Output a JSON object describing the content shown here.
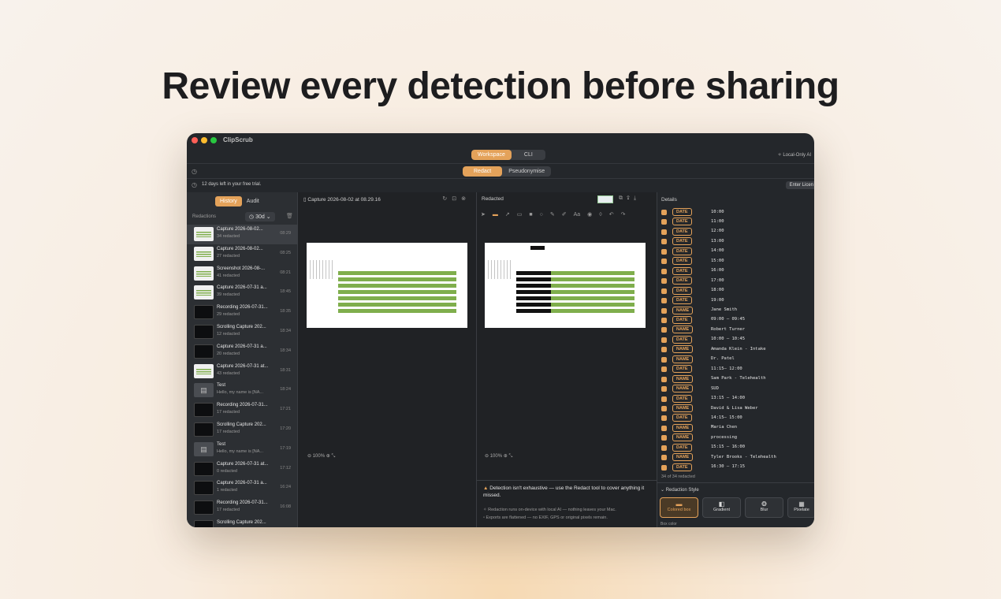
{
  "headline": "Review every detection before sharing",
  "app_title": "ClipScrub",
  "mode_tabs": [
    "Workspace",
    "CLI"
  ],
  "action_tabs": [
    "Redact",
    "Pseudonymise"
  ],
  "local_ai": "Local-Only AI",
  "trial_text": "12 days left in your free trial.",
  "enter_license": "Enter Licen",
  "left_tabs": [
    "History",
    "Audit"
  ],
  "redactions_label": "Redactions",
  "duration": "30d",
  "history": [
    {
      "name": "Capture 2026-08-02...",
      "sub": "34 redacted",
      "time": "08:29",
      "thumb": "light"
    },
    {
      "name": "Capture 2026-08-02...",
      "sub": "27 redacted",
      "time": "08:25",
      "thumb": "light"
    },
    {
      "name": "Screenshot 2026-08-...",
      "sub": "41 redacted",
      "time": "08:21",
      "thumb": "light"
    },
    {
      "name": "Capture 2026-07-31 a...",
      "sub": "39 redacted",
      "time": "18:45",
      "thumb": "light"
    },
    {
      "name": "Recording 2026-07-31...",
      "sub": "29 redacted",
      "time": "18:35",
      "thumb": "dark"
    },
    {
      "name": "Scrolling Capture 202...",
      "sub": "12 redacted",
      "time": "18:34",
      "thumb": "dark"
    },
    {
      "name": "Capture 2026-07-31 a...",
      "sub": "20 redacted",
      "time": "18:34",
      "thumb": "dark"
    },
    {
      "name": "Capture 2026-07-31 at...",
      "sub": "43 redacted",
      "time": "18:31",
      "thumb": "light"
    },
    {
      "name": "Test",
      "sub": "Hello, my name is [NA...",
      "time": "18:24",
      "thumb": "doc"
    },
    {
      "name": "Recording 2026-07-31...",
      "sub": "17 redacted",
      "time": "17:21",
      "thumb": "dark"
    },
    {
      "name": "Scrolling Capture 202...",
      "sub": "17 redacted",
      "time": "17:20",
      "thumb": "dark"
    },
    {
      "name": "Test",
      "sub": "Hello, my name is [NA...",
      "time": "17:19",
      "thumb": "doc"
    },
    {
      "name": "Capture 2026-07-31 at...",
      "sub": "0 redacted",
      "time": "17:12",
      "thumb": "dark"
    },
    {
      "name": "Capture 2026-07-31 a...",
      "sub": "1 redacted",
      "time": "16:24",
      "thumb": "dark"
    },
    {
      "name": "Recording 2026-07-31...",
      "sub": "17 redacted",
      "time": "16:08",
      "thumb": "dark"
    },
    {
      "name": "Scrolling Capture 202...",
      "sub": "",
      "time": "",
      "thumb": "dark"
    }
  ],
  "original_pane_title": "Capture 2026-08-02 at 08.29.16",
  "redacted_pane_title": "Redacted",
  "zoom_original": "100%",
  "zoom_redacted": "100%",
  "warning": "Detection isn't exhaustive — use the Redact tool to cover anything it missed.",
  "note1": "Redaction runs on-device with local AI — nothing leaves your Mac.",
  "note2": "Exports are flattened — no EXIF, GPS or original pixels remain.",
  "details_title": "Details",
  "detections": [
    {
      "tag": "DATE",
      "value": "10:00"
    },
    {
      "tag": "DATE",
      "value": "11:00"
    },
    {
      "tag": "DATE",
      "value": "12:00"
    },
    {
      "tag": "DATE",
      "value": "13:00"
    },
    {
      "tag": "DATE",
      "value": "14:00"
    },
    {
      "tag": "DATE",
      "value": "15:00"
    },
    {
      "tag": "DATE",
      "value": "16:00"
    },
    {
      "tag": "DATE",
      "value": "17:00"
    },
    {
      "tag": "DATE",
      "value": "18:00"
    },
    {
      "tag": "DATE",
      "value": "19:00"
    },
    {
      "tag": "NAME",
      "value": "Jane Smith"
    },
    {
      "tag": "DATE",
      "value": "09:00 – 09:45"
    },
    {
      "tag": "NAME",
      "value": "Robert Turner"
    },
    {
      "tag": "DATE",
      "value": "10:00 – 10:45"
    },
    {
      "tag": "NAME",
      "value": "Amanda Klein - Intake"
    },
    {
      "tag": "NAME",
      "value": "Dr. Patel"
    },
    {
      "tag": "DATE",
      "value": "11:15– 12:00"
    },
    {
      "tag": "NAME",
      "value": "Sam Park - Telehealth"
    },
    {
      "tag": "NAME",
      "value": "SUD"
    },
    {
      "tag": "DATE",
      "value": "13:15 – 14:00"
    },
    {
      "tag": "NAME",
      "value": "David & Lisa Weber"
    },
    {
      "tag": "DATE",
      "value": "14:15– 15:00"
    },
    {
      "tag": "NAME",
      "value": "Maria Chen"
    },
    {
      "tag": "NAME",
      "value": "processing"
    },
    {
      "tag": "DATE",
      "value": "15:15 – 16:00"
    },
    {
      "tag": "NAME",
      "value": "Tyler Brooks - Telehealth"
    },
    {
      "tag": "DATE",
      "value": "16:30 – 17:15"
    }
  ],
  "count_text": "34 of 34 redacted",
  "style_title": "Redaction Style",
  "styles": [
    "Colored box",
    "Gradient",
    "Blur",
    "Pixelate"
  ],
  "box_color_label": "Box color",
  "colors": {
    "accent": "#e4a25a",
    "green_bar": "#7fae4c"
  }
}
